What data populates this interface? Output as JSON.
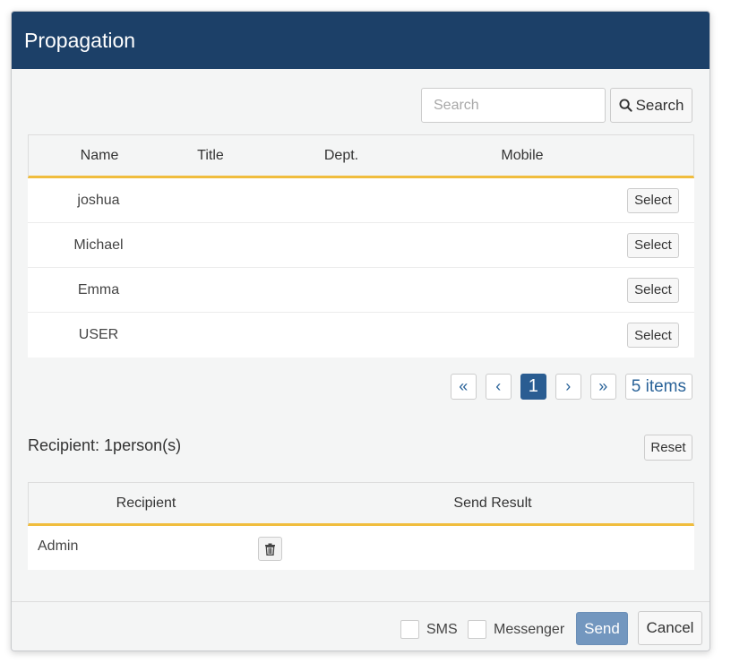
{
  "dialog": {
    "title": "Propagation"
  },
  "search": {
    "placeholder": "Search",
    "value": "",
    "button_label": "Search"
  },
  "users_table": {
    "headers": {
      "name": "Name",
      "title": "Title",
      "dept": "Dept.",
      "mobile": "Mobile"
    },
    "rows": [
      {
        "name": "joshua",
        "title": "",
        "dept": "",
        "mobile": "",
        "action": "Select"
      },
      {
        "name": "Michael",
        "title": "",
        "dept": "",
        "mobile": "",
        "action": "Select"
      },
      {
        "name": "Emma",
        "title": "",
        "dept": "",
        "mobile": "",
        "action": "Select"
      },
      {
        "name": "USER",
        "title": "",
        "dept": "",
        "mobile": "",
        "action": "Select"
      }
    ]
  },
  "pagination": {
    "first": "«",
    "prev": "‹",
    "current_page": "1",
    "next": "›",
    "last": "»",
    "total_items": "5 items"
  },
  "recipients": {
    "summary": "Recipient: 1person(s)",
    "reset_label": "Reset",
    "headers": {
      "recipient": "Recipient",
      "send_result": "Send Result"
    },
    "rows": [
      {
        "recipient": "Admin",
        "send_result": ""
      }
    ]
  },
  "footer": {
    "sms_label": "SMS",
    "messenger_label": "Messenger",
    "send_label": "Send",
    "cancel_label": "Cancel"
  },
  "colors": {
    "header_bg": "#1c4068",
    "accent_underline": "#f0bd3d",
    "active_page": "#2a5d92",
    "send_button": "#7397bf"
  },
  "icons": {
    "search": "magnifier-icon",
    "delete": "trash-icon"
  }
}
